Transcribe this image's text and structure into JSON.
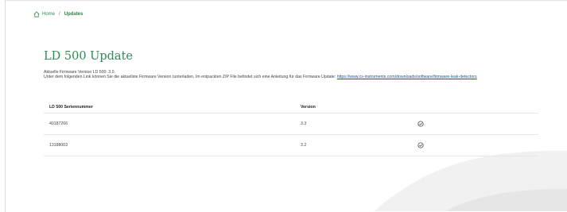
{
  "breadcrumb": {
    "home_icon": "home-icon",
    "home_label": "Home",
    "separator": "/",
    "current_label": "Updates"
  },
  "page": {
    "title": "LD 500 Update",
    "intro_line1": "Aktuelle Firmware Version LD 500: 3.0.",
    "intro_line2": "Unter dem folgenden Link können Sie die aktuellste Firmware Version runterladen. Im entpackten ZIP File befindet sich eine Anleitung für das Firmware Update: ",
    "link_text": "https://www.cs-instruments.com/downloads/software/firmware-leak-detectors"
  },
  "table": {
    "headers": {
      "serial": "LD 500 Seriennummer",
      "version": "Version"
    },
    "rows": [
      {
        "serial": "40187266",
        "version": "3.3",
        "status_icon": "check-circle-icon"
      },
      {
        "serial": "13188003",
        "version": "3.2",
        "status_icon": "check-circle-icon"
      }
    ]
  },
  "colors": {
    "accent": "#2e8b57",
    "link": "#1a4fa0"
  }
}
